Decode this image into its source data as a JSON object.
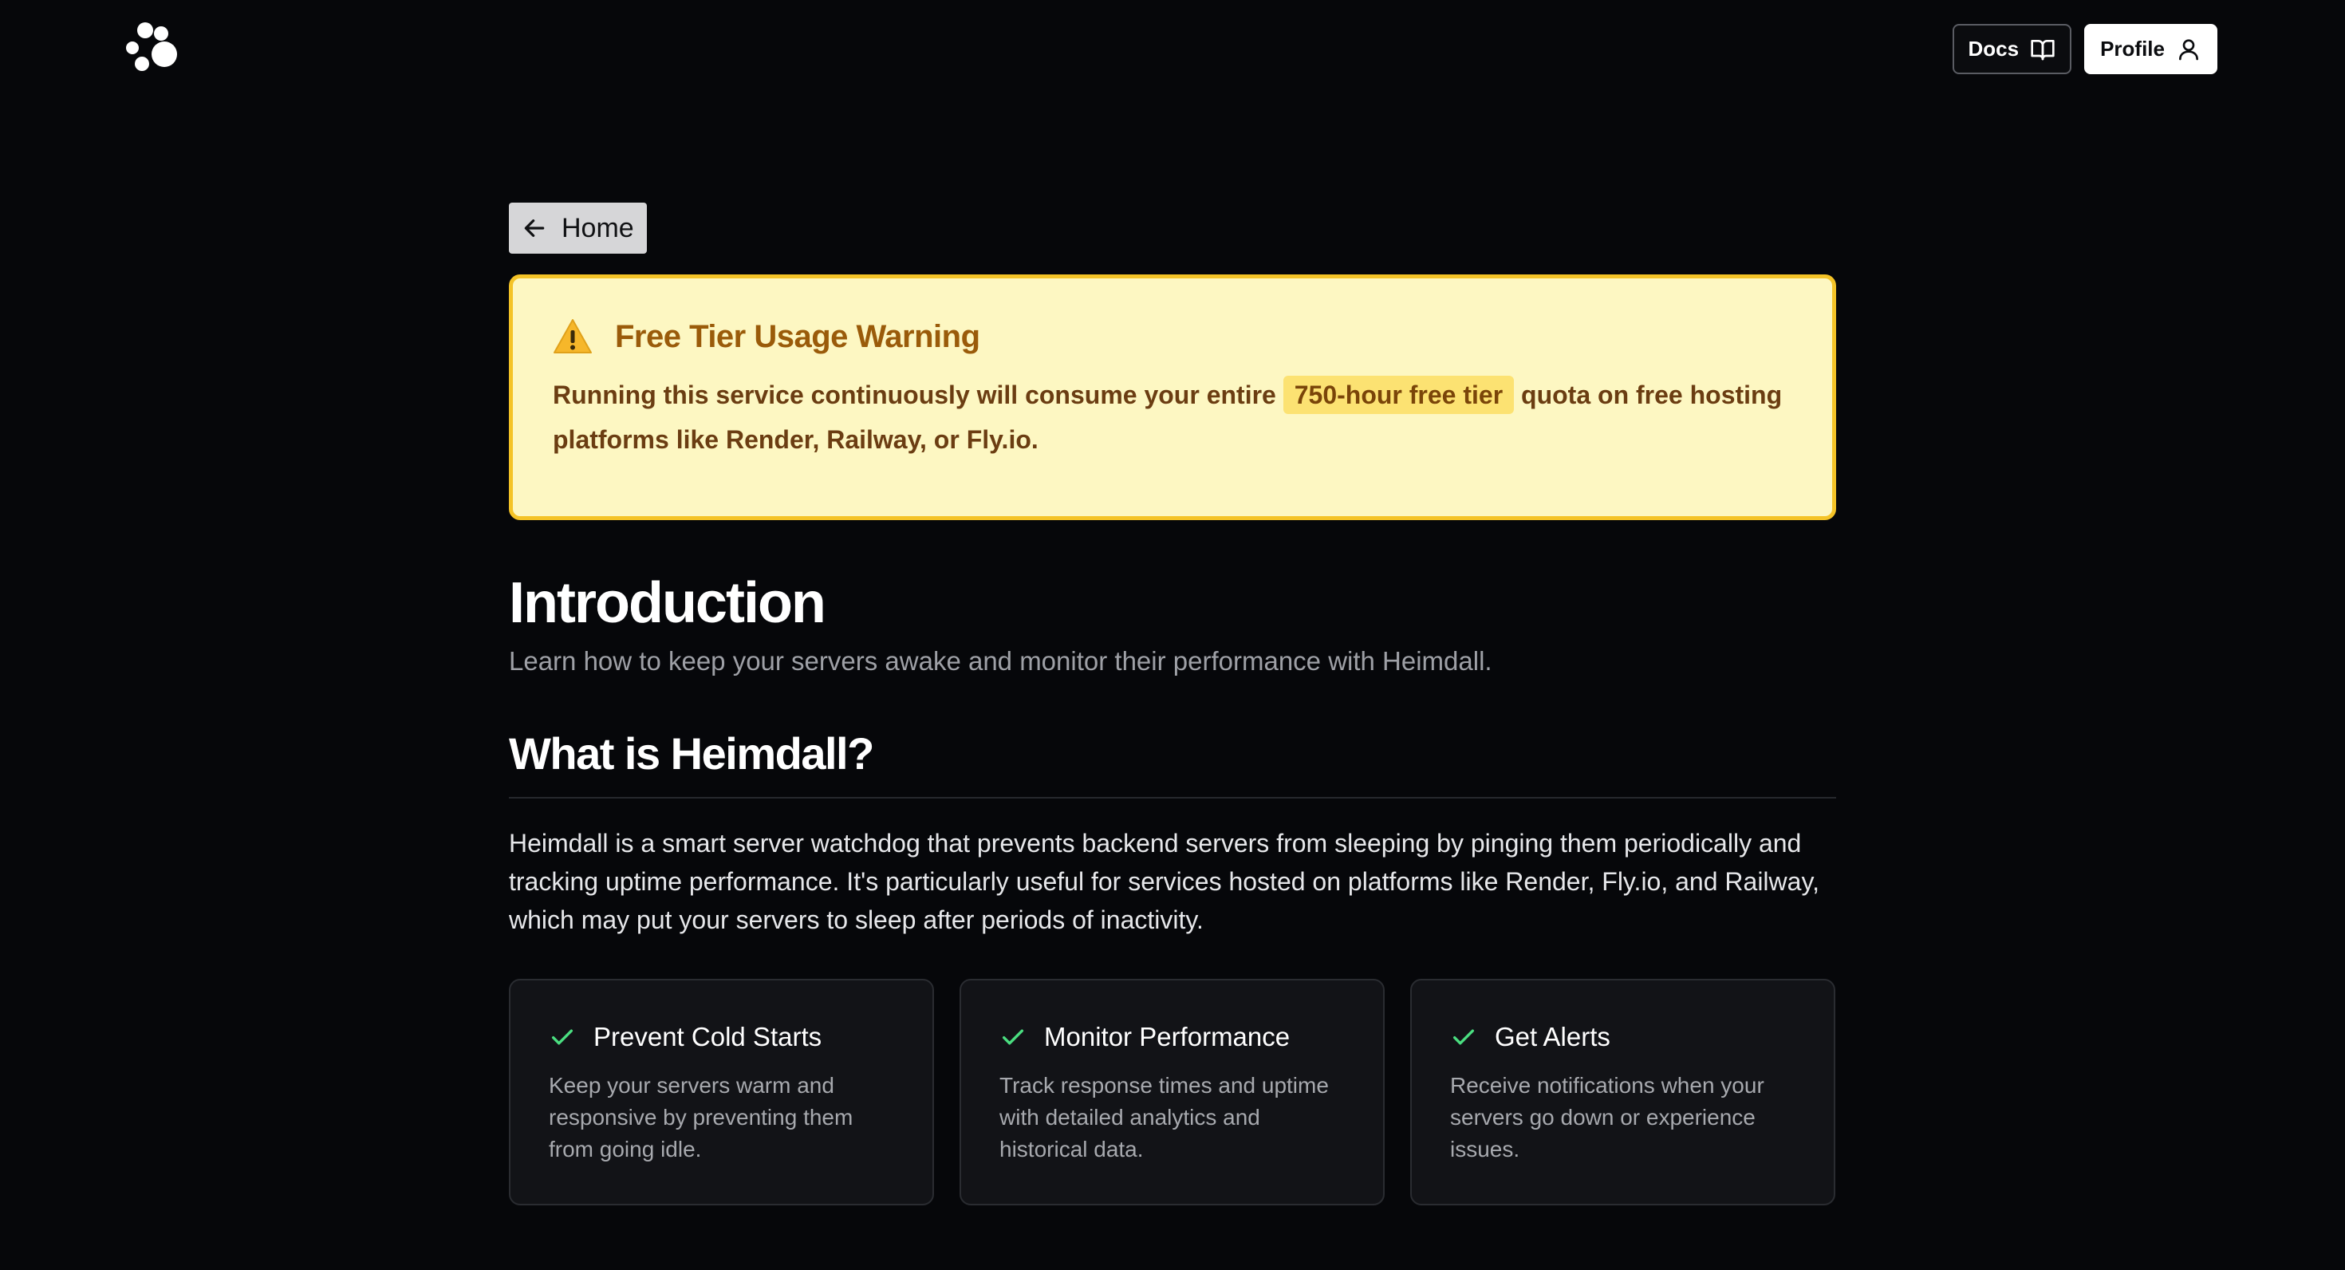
{
  "header": {
    "logo_icon": "paw-dots-icon",
    "docs_label": "Docs",
    "docs_icon": "book-open-icon",
    "profile_label": "Profile",
    "profile_icon": "user-icon"
  },
  "nav": {
    "home_label": "Home",
    "home_icon": "arrow-left-icon"
  },
  "warning": {
    "icon": "warning-triangle-icon",
    "title": "Free Tier Usage Warning",
    "text_before": "Running this service continuously will consume your entire ",
    "highlight": "750-hour free tier",
    "text_after": " quota on free hosting platforms like Render, Railway, or Fly.io."
  },
  "intro": {
    "title": "Introduction",
    "subtitle": "Learn how to keep your servers awake and monitor their performance with Heimdall."
  },
  "what": {
    "title": "What is Heimdall?",
    "description": "Heimdall is a smart server watchdog that prevents backend servers from sleeping by pinging them periodically and tracking uptime performance. It's particularly useful for services hosted on platforms like Render, Fly.io, and Railway, which may put your servers to sleep after periods of inactivity."
  },
  "features": [
    {
      "icon": "check-icon",
      "title": "Prevent Cold Starts",
      "description": "Keep your servers warm and responsive by preventing them from going idle."
    },
    {
      "icon": "check-icon",
      "title": "Monitor Performance",
      "description": "Track response times and uptime with detailed analytics and historical data."
    },
    {
      "icon": "check-icon",
      "title": "Get Alerts",
      "description": "Receive notifications when your servers go down or experience issues."
    }
  ],
  "colors": {
    "background": "#06070a",
    "warning_bg": "#fdf7c2",
    "warning_border": "#f4c327",
    "highlight_bg": "#fce272",
    "check_green": "#4ade80"
  }
}
